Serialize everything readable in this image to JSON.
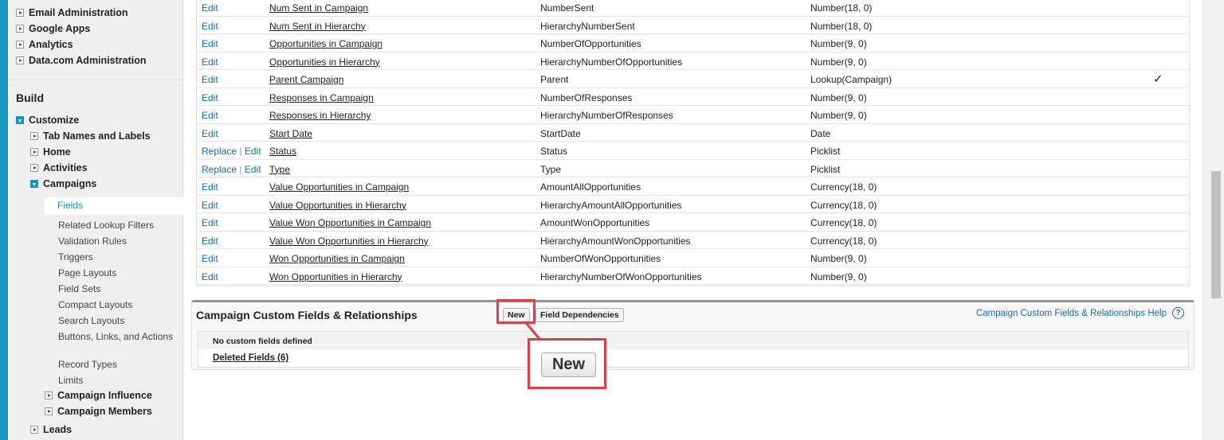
{
  "sidebar": {
    "top_items": [
      "Email Administration",
      "Google Apps",
      "Analytics",
      "Data.com Administration"
    ],
    "build_heading": "Build",
    "customize": "Customize",
    "customize_items": [
      "Tab Names and Labels",
      "Home",
      "Activities"
    ],
    "campaigns": "Campaigns",
    "campaign_subitems": [
      "Fields",
      "Related Lookup Filters",
      "Validation Rules",
      "Triggers",
      "Page Layouts",
      "Field Sets",
      "Compact Layouts",
      "Search Layouts",
      "Buttons, Links, and Actions",
      "Record Types",
      "Limits"
    ],
    "campaign_children": [
      "Campaign Influence",
      "Campaign Members"
    ],
    "leads": "Leads"
  },
  "fields_table": {
    "rows": [
      {
        "action": "Edit",
        "label": "Num Sent in Campaign",
        "name": "NumberSent",
        "type": "Number(18, 0)"
      },
      {
        "action": "Edit",
        "label": "Num Sent in Hierarchy",
        "name": "HierarchyNumberSent",
        "type": "Number(18, 0)"
      },
      {
        "action": "Edit",
        "label": "Opportunities in Campaign",
        "name": "NumberOfOpportunities",
        "type": "Number(9, 0)"
      },
      {
        "action": "Edit",
        "label": "Opportunities in Hierarchy",
        "name": "HierarchyNumberOfOpportunities",
        "type": "Number(9, 0)"
      },
      {
        "action": "Edit",
        "label": "Parent Campaign",
        "name": "Parent",
        "type": "Lookup(Campaign)",
        "check": "✓"
      },
      {
        "action": "Edit",
        "label": "Responses in Campaign",
        "name": "NumberOfResponses",
        "type": "Number(9, 0)"
      },
      {
        "action": "Edit",
        "label": "Responses in Hierarchy",
        "name": "HierarchyNumberOfResponses",
        "type": "Number(9, 0)"
      },
      {
        "action": "Edit",
        "label": "Start Date",
        "name": "StartDate",
        "type": "Date"
      },
      {
        "action": "Replace | Edit",
        "label": "Status",
        "name": "Status",
        "type": "Picklist"
      },
      {
        "action": "Replace | Edit",
        "label": "Type",
        "name": "Type",
        "type": "Picklist"
      },
      {
        "action": "Edit",
        "label": "Value Opportunities in Campaign",
        "name": "AmountAllOpportunities",
        "type": "Currency(18, 0)"
      },
      {
        "action": "Edit",
        "label": "Value Opportunities in Hierarchy",
        "name": "HierarchyAmountAllOpportunities",
        "type": "Currency(18, 0)"
      },
      {
        "action": "Edit",
        "label": "Value Won Opportunities in Campaign",
        "name": "AmountWonOpportunities",
        "type": "Currency(18, 0)"
      },
      {
        "action": "Edit",
        "label": "Value Won Opportunities in Hierarchy",
        "name": "HierarchyAmountWonOpportunities",
        "type": "Currency(18, 0)"
      },
      {
        "action": "Edit",
        "label": "Won Opportunities in Campaign",
        "name": "NumberOfWonOpportunities",
        "type": "Number(9, 0)"
      },
      {
        "action": "Edit",
        "label": "Won Opportunities in Hierarchy",
        "name": "HierarchyNumberOfWonOpportunities",
        "type": "Number(9, 0)"
      }
    ]
  },
  "custom_panel": {
    "title": "Campaign Custom Fields & Relationships",
    "new_label": "New",
    "deps_label": "Field Dependencies",
    "help_link": "Campaign Custom Fields & Relationships Help",
    "help_icon": "?",
    "empty_text": "No custom fields defined",
    "deleted_link": "Deleted Fields (6)"
  },
  "callout": {
    "label": "New",
    "color": "#d9414a"
  }
}
